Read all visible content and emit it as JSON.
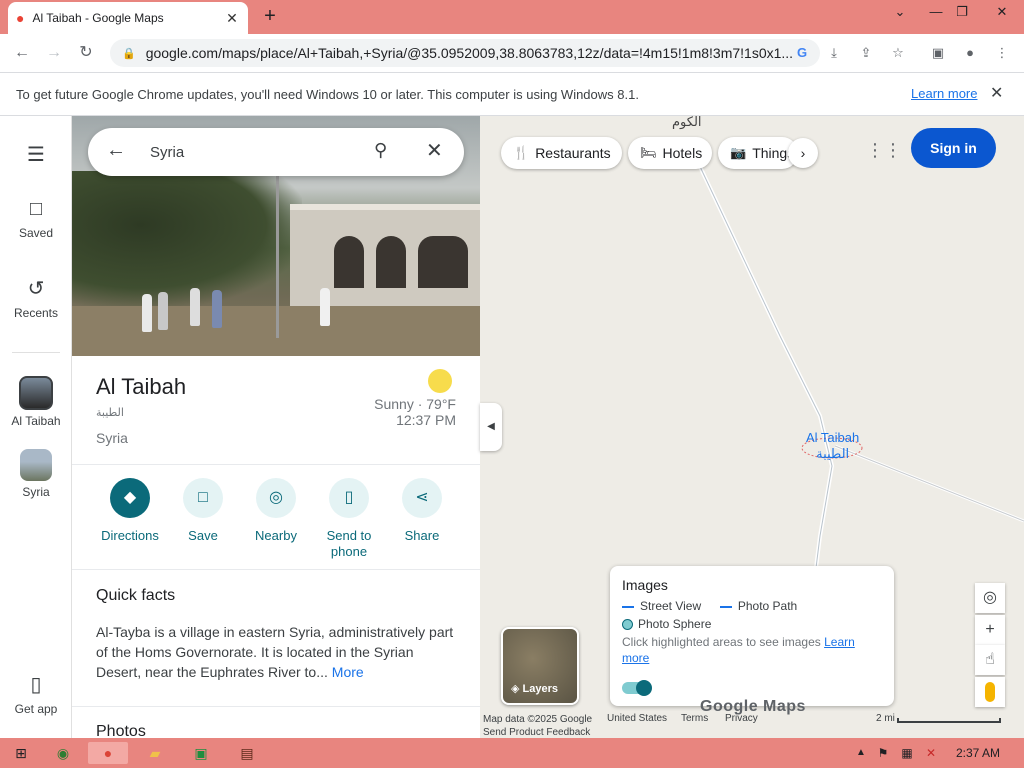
{
  "browser": {
    "tab_title": "Al Taibah - Google Maps",
    "url": "google.com/maps/place/Al+Taibah,+Syria/@35.0952009,38.8063783,12z/data=!4m15!1m8!3m7!1s0x1...",
    "infobar_message": "To get future Google Chrome updates, you'll need Windows 10 or later. This computer is using Windows 8.1.",
    "infobar_link": "Learn more"
  },
  "rail": {
    "saved": "Saved",
    "recents": "Recents",
    "current": "Al Taibah",
    "previous": "Syria",
    "get_app": "Get app"
  },
  "search": {
    "value": "Syria"
  },
  "place": {
    "name": "Al Taibah",
    "name_arabic": "الطيبة",
    "country": "Syria",
    "weather": "Sunny · 79°F",
    "time": "12:37 PM",
    "actions": [
      {
        "label": "Directions"
      },
      {
        "label": "Save"
      },
      {
        "label": "Nearby"
      },
      {
        "label": "Send to phone"
      },
      {
        "label": "Share"
      }
    ],
    "quick_facts_title": "Quick facts",
    "quick_facts_body": "Al-Tayba is a village in eastern Syria, administratively part of the Homs Governorate. It is located in the Syrian Desert, near the Euphrates River to... ",
    "quick_facts_more": "More",
    "photos_title": "Photos"
  },
  "map": {
    "chips": [
      {
        "label": "Restaurants",
        "icon": "restaurant-icon"
      },
      {
        "label": "Hotels",
        "icon": "hotel-icon"
      },
      {
        "label": "Things",
        "icon": "camera-icon"
      }
    ],
    "sign_in": "Sign in",
    "label_kawm": "الكوم",
    "label_taibah": "Al Taibah",
    "label_taibah_ar": "الطيبة",
    "images_card": {
      "title": "Images",
      "street_view": "Street View",
      "photo_path": "Photo Path",
      "photo_sphere": "Photo Sphere",
      "hint": "Click highlighted areas to see images ",
      "hint_link": "Learn more"
    },
    "layers": "Layers",
    "logo": "Google Maps",
    "map_data": "Map data ©2025 Google",
    "send_feedback": "Send Product Feedback",
    "united_states": "United States",
    "terms": "Terms",
    "privacy": "Privacy",
    "scale": "2 mi"
  },
  "taskbar": {
    "clock": "2:37 AM"
  },
  "colors": {
    "accent": "#0b6a7a",
    "signin": "#0b57d0",
    "chrome_frame": "#e8857f"
  }
}
